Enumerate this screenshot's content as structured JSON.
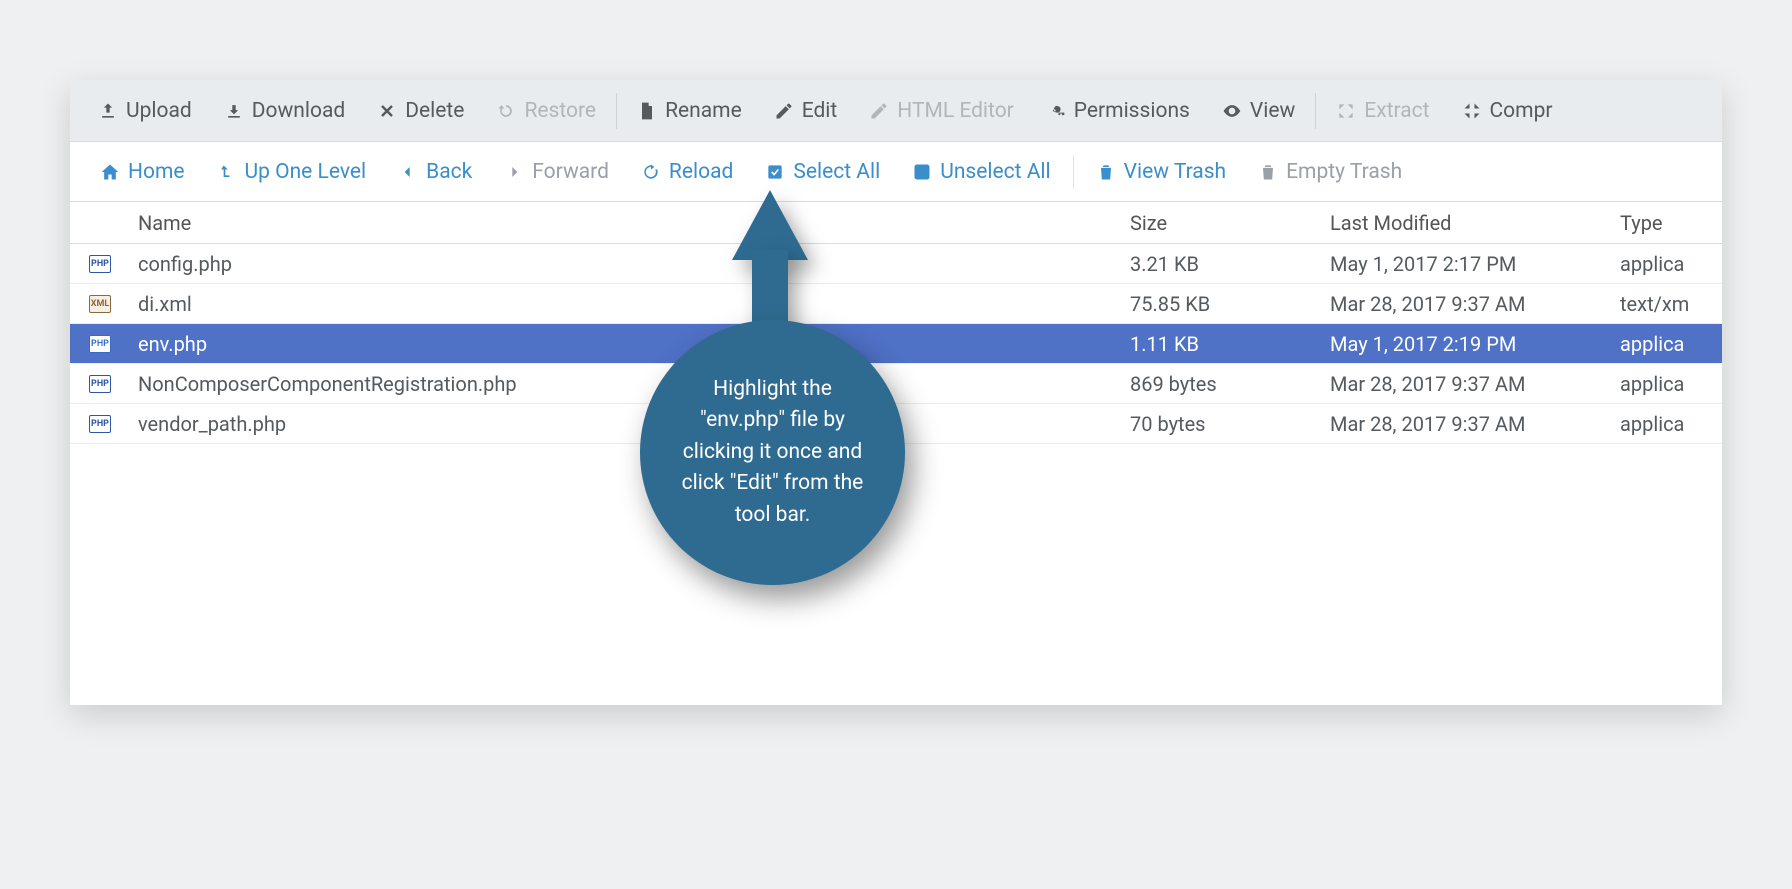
{
  "toolbar": {
    "upload": "Upload",
    "download": "Download",
    "delete": "Delete",
    "restore": "Restore",
    "rename": "Rename",
    "edit": "Edit",
    "html_editor": "HTML Editor",
    "permissions": "Permissions",
    "view": "View",
    "extract": "Extract",
    "compress": "Compr"
  },
  "nav": {
    "home": "Home",
    "up": "Up One Level",
    "back": "Back",
    "forward": "Forward",
    "reload": "Reload",
    "select_all": "Select All",
    "unselect_all": "Unselect All",
    "view_trash": "View Trash",
    "empty_trash": "Empty Trash"
  },
  "columns": {
    "name": "Name",
    "size": "Size",
    "last_modified": "Last Modified",
    "type": "Type"
  },
  "files": [
    {
      "icon": "PHP",
      "name": "config.php",
      "size": "3.21 KB",
      "modified": "May 1, 2017 2:17 PM",
      "type": "applica",
      "selected": false
    },
    {
      "icon": "XML",
      "name": "di.xml",
      "size": "75.85 KB",
      "modified": "Mar 28, 2017 9:37 AM",
      "type": "text/xm",
      "selected": false
    },
    {
      "icon": "PHP",
      "name": "env.php",
      "size": "1.11 KB",
      "modified": "May 1, 2017 2:19 PM",
      "type": "applica",
      "selected": true
    },
    {
      "icon": "PHP",
      "name": "NonComposerComponentRegistration.php",
      "size": "869 bytes",
      "modified": "Mar 28, 2017 9:37 AM",
      "type": "applica",
      "selected": false
    },
    {
      "icon": "PHP",
      "name": "vendor_path.php",
      "size": "70 bytes",
      "modified": "Mar 28, 2017 9:37 AM",
      "type": "applica",
      "selected": false
    }
  ],
  "callout": {
    "text": "Highlight the \"env.php\" file by clicking it once and click \"Edit\" from the tool bar."
  }
}
